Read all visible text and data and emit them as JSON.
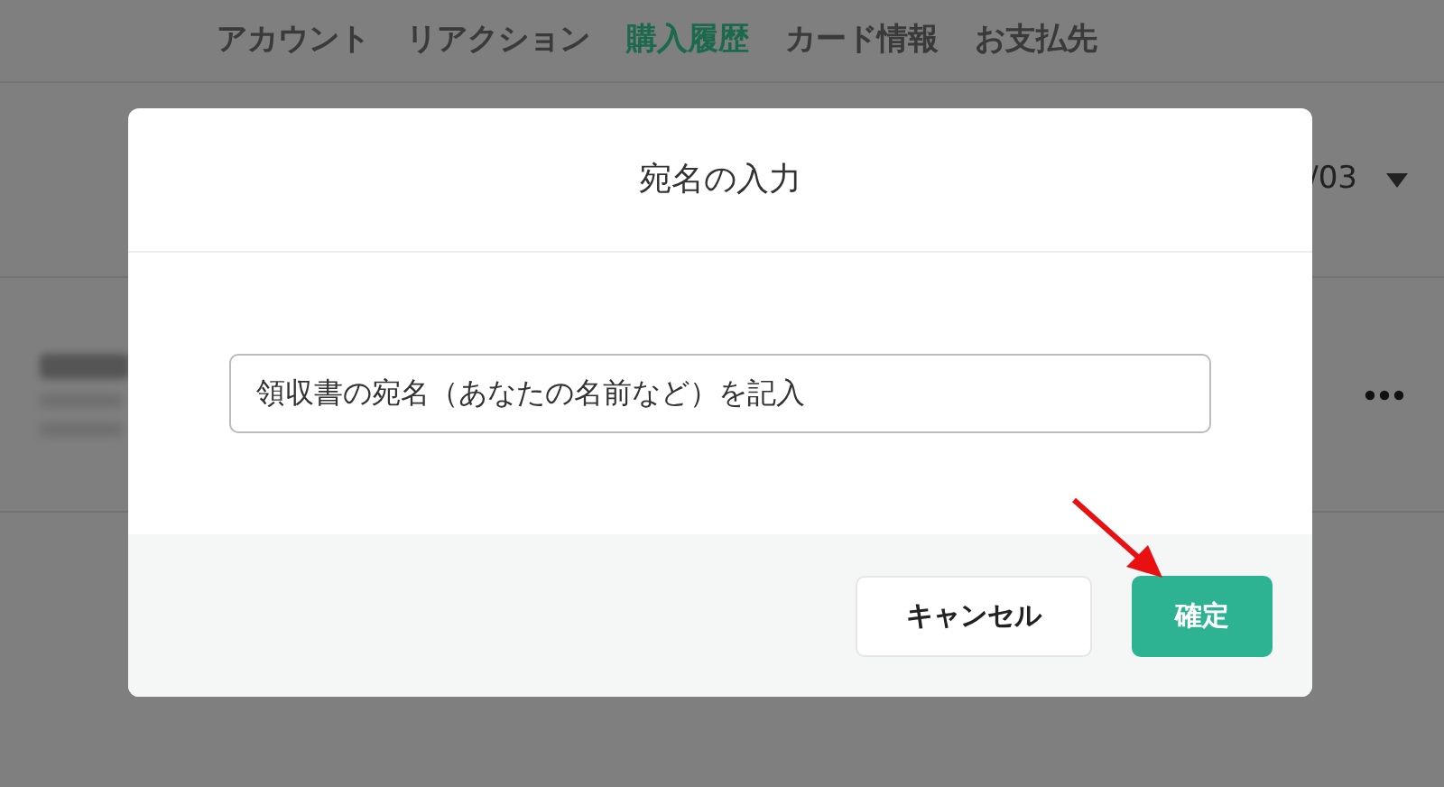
{
  "tabs": [
    {
      "label": "アカウント",
      "selected": false
    },
    {
      "label": "リアクション",
      "selected": false
    },
    {
      "label": "購入履歴",
      "selected": true
    },
    {
      "label": "カード情報",
      "selected": false
    },
    {
      "label": "お支払先",
      "selected": false
    }
  ],
  "month_select": {
    "value": "/03"
  },
  "dialog": {
    "title": "宛名の入力",
    "field": {
      "value": "領収書の宛名（あなたの名前など）を記入"
    },
    "buttons": [
      {
        "label": "キャンセル",
        "kind": "secondary"
      },
      {
        "label": "確定",
        "kind": "primary"
      }
    ]
  }
}
